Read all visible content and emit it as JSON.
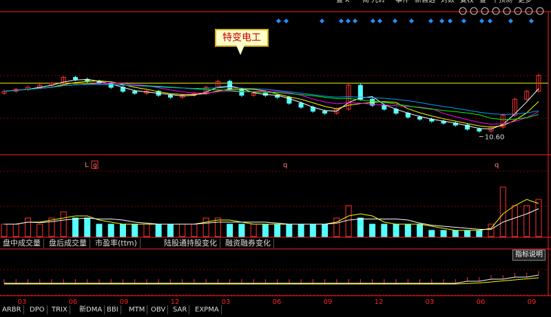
{
  "toolbar": {
    "items": [
      "叠 K",
      "简·九转",
      "事件",
      "新自选",
      "対数",
      "复权",
      "叠",
      "十预测",
      "更多"
    ],
    "icon_names": [
      "eye-icon",
      "image-icon",
      "play-icon",
      "record-icon",
      "scissors-icon",
      "settings-icon",
      "plus-icon",
      "minus-icon"
    ]
  },
  "callout": {
    "label": "特变电工"
  },
  "markers": {
    "low_label": "10.60",
    "letters": [
      "L",
      "g",
      "q",
      "q"
    ]
  },
  "tabs": [
    "盘中成交量",
    "盘后成交量",
    "市盈率(ttm)",
    "陆股通持股变化",
    "融资融券变化"
  ],
  "index_button": "指标说明",
  "bottom_tabs": [
    "ARBR",
    "DPO",
    "TRIX",
    "新DMA",
    "BBI",
    "MTM",
    "OBV",
    "SAR",
    "EXPMA"
  ],
  "colors": {
    "up": "#ff3030",
    "down": "#54ffff",
    "ma5": "#ffffff",
    "ma10": "#ffff00",
    "ma20": "#ff00ff",
    "ma30": "#00ff00",
    "ma60": "#00a0ff",
    "hline": "#ffff00",
    "grid": "#8b0000",
    "axis": "#ff2020",
    "diamond": "#1e90ff"
  },
  "chart_data": [
    {
      "type": "candlestick",
      "title": "",
      "x_ticks": [
        "03",
        "06",
        "09",
        "12",
        "03",
        "06",
        "09",
        "12",
        "03",
        "06",
        "09"
      ],
      "annotation": "10.60",
      "horizontal_line": "yellow",
      "series": [
        {
          "name": "K",
          "close": [
            12.6,
            12.7,
            12.8,
            12.9,
            13.0,
            13.3,
            13.2,
            13.1,
            13.0,
            12.8,
            12.6,
            12.5,
            12.6,
            12.4,
            12.3,
            12.4,
            12.5,
            12.8,
            13.1,
            12.7,
            12.4,
            12.5,
            12.4,
            12.3,
            12.0,
            11.8,
            11.6,
            11.5,
            11.7,
            12.9,
            12.2,
            11.9,
            11.7,
            11.5,
            11.3,
            11.2,
            11.1,
            11.0,
            10.9,
            10.7,
            10.6,
            10.8,
            11.4,
            12.2,
            12.6,
            13.4
          ]
        }
      ]
    },
    {
      "type": "bar",
      "title": "盘中成交量",
      "values": [
        2,
        2,
        3,
        2,
        3,
        4,
        3,
        3,
        2,
        2,
        2,
        2,
        2,
        2,
        2,
        2,
        2,
        3,
        3,
        2,
        2,
        2,
        2,
        2,
        2,
        2,
        2,
        2,
        3,
        5,
        3,
        2,
        2,
        2,
        2,
        2,
        1,
        1,
        1,
        1,
        1,
        2,
        8,
        5,
        5,
        6
      ]
    },
    {
      "type": "line",
      "title": "",
      "series": [
        {
          "values": [
            2,
            2,
            2,
            2,
            2,
            2,
            2,
            2,
            2,
            2,
            2,
            2,
            2,
            2,
            2,
            2,
            2,
            2,
            2,
            2,
            2,
            2,
            2,
            2,
            2,
            2,
            2,
            2,
            2,
            2,
            2,
            2,
            2,
            2,
            2,
            2,
            2,
            2,
            2,
            3,
            3,
            4,
            4,
            5,
            5,
            6
          ]
        }
      ]
    }
  ]
}
